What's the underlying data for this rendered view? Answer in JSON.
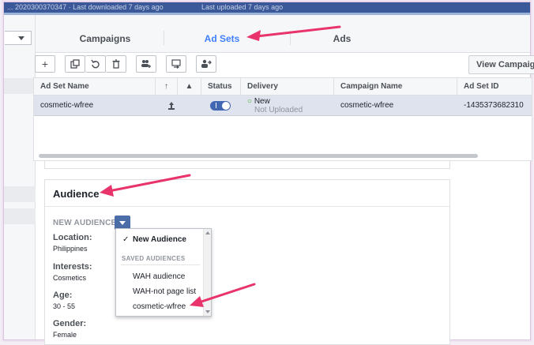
{
  "topbar": {
    "left_text": "... 2020300370347 · Last downloaded 7 days ago",
    "right_text": "Last uploaded 7 days ago"
  },
  "tabs": [
    {
      "label": "Campaigns",
      "active": false
    },
    {
      "label": "Ad Sets",
      "active": true
    },
    {
      "label": "Ads",
      "active": false
    }
  ],
  "toolbar": {
    "icons": [
      "plus-icon",
      "duplicate-icon",
      "revert-icon",
      "trash-icon",
      "add-people-icon",
      "swap-icon",
      "share-person-icon"
    ],
    "view_button_label": "View Campaig"
  },
  "table": {
    "columns": [
      "Ad Set Name",
      "",
      "",
      "Status",
      "Delivery",
      "Campaign Name",
      "Ad Set ID"
    ],
    "rows": [
      {
        "name": "cosmetic-wfree",
        "status_on": true,
        "delivery_status": "New",
        "delivery_sub": "Not Uploaded",
        "campaign": "cosmetic-wfree",
        "id": "-1435373682310"
      }
    ]
  },
  "audience": {
    "title": "Audience",
    "new_audience_label": "NEW AUDIENCE",
    "fields": [
      {
        "label": "Location:",
        "value": "Philippines"
      },
      {
        "label": "Interests:",
        "value": "Cosmetics"
      },
      {
        "label": "Age:",
        "value": "30 - 55"
      },
      {
        "label": "Gender:",
        "value": "Female"
      }
    ]
  },
  "dropdown": {
    "selected": "New Audience",
    "section_label": "SAVED AUDIENCES",
    "items": [
      "WAH audience",
      "WAH-not page list",
      "cosmetic-wfree"
    ]
  },
  "colors": {
    "accent": "#4080ff",
    "brand_bar": "#3b5998",
    "arrow": "#e8336b"
  }
}
